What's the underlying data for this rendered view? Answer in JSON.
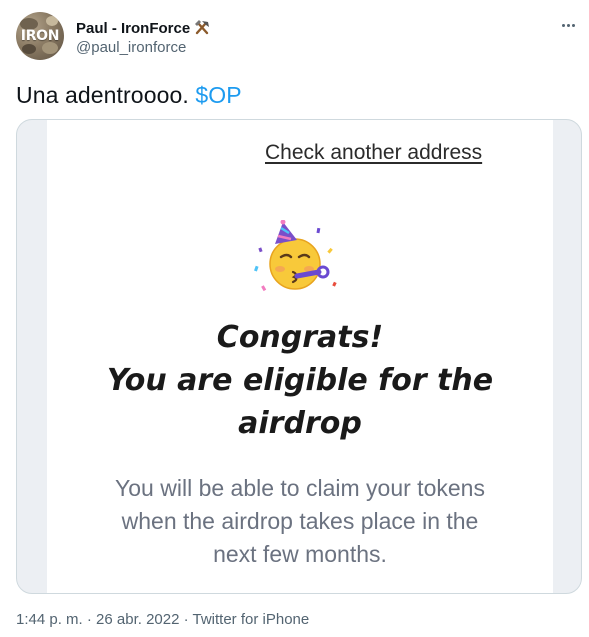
{
  "author": {
    "avatar_text": "IRON",
    "display_name": "Paul - IronForce",
    "badge_icon": "hammer-pick-icon",
    "handle": "@paul_ironforce"
  },
  "tweet": {
    "text": "Una adentroooo.",
    "cashtag": "$OP"
  },
  "media": {
    "link_text": "Check another address",
    "emoji": "partying-face-icon",
    "headline_line1": "Congrats!",
    "headline_line2": "You are eligible for the",
    "headline_line3": "airdrop",
    "subtext_line1": "You will be able to claim your tokens",
    "subtext_line2": "when the airdrop takes place in the",
    "subtext_line3": "next few months."
  },
  "meta": {
    "timestamp": "1:44 p. m. · 26 abr. 2022 · Twitter for iPhone"
  },
  "colors": {
    "link": "#1d9bf0",
    "secondary_text": "#536471",
    "media_bg": "#eceff3"
  }
}
